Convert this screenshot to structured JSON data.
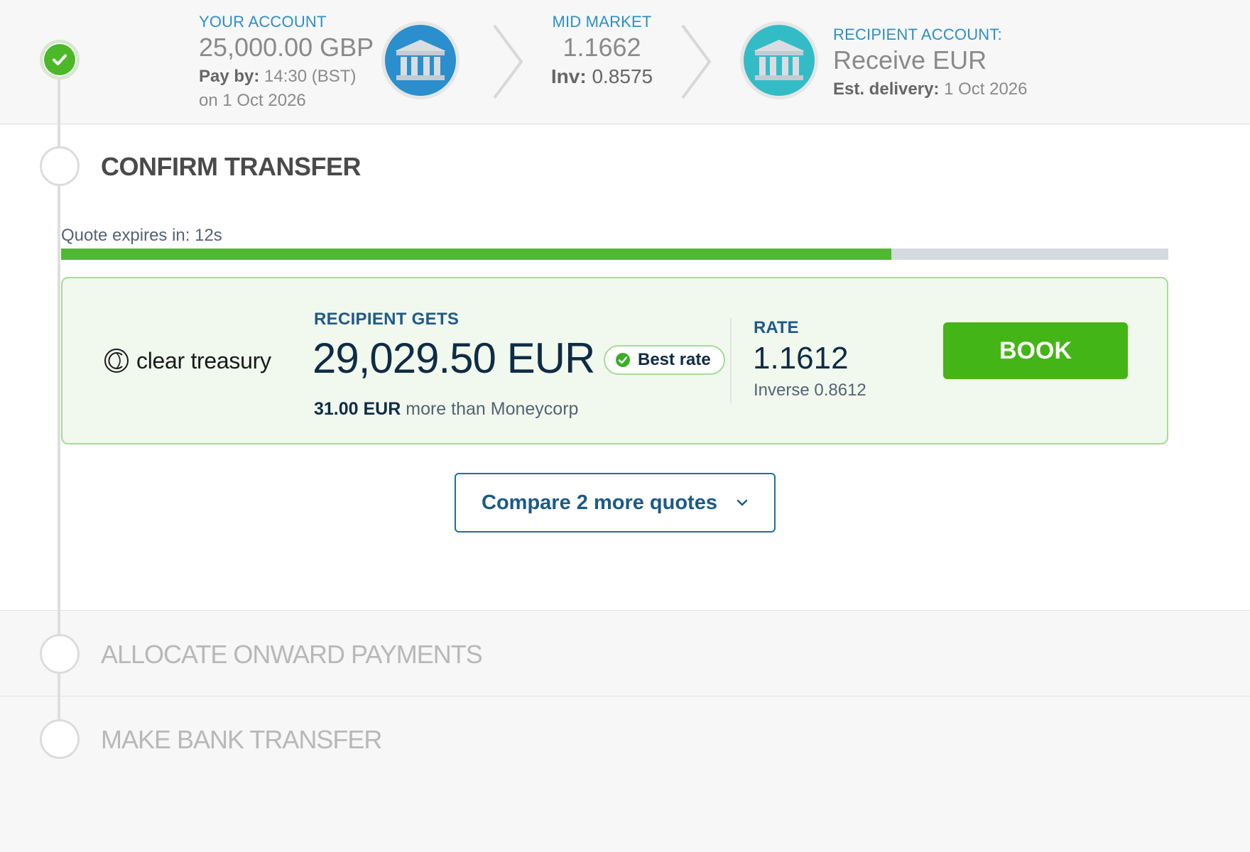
{
  "summary": {
    "your_account": {
      "label": "YOUR ACCOUNT",
      "amount": "25,000.00 GBP",
      "pay_by_label": "Pay by:",
      "pay_by_time": "14:30 (BST)",
      "pay_by_date": "on 1 Oct 2026"
    },
    "mid_market": {
      "label": "MID MARKET",
      "rate": "1.1662",
      "inv_label": "Inv:",
      "inv_value": "0.8575"
    },
    "recipient": {
      "label": "RECIPIENT ACCOUNT:",
      "receive": "Receive EUR",
      "delivery_label": "Est. delivery:",
      "delivery_date": "1 Oct 2026"
    }
  },
  "confirm": {
    "title": "CONFIRM TRANSFER",
    "expires_text": "Quote expires in: 12s",
    "progress_fraction": 0.75
  },
  "quote": {
    "provider": "clear treasury",
    "recipient_gets_label": "RECIPIENT GETS",
    "amount": "29,029.50 EUR",
    "best_rate_badge": "Best rate",
    "diff_amount": "31.00 EUR",
    "diff_text": "more than Moneycorp",
    "rate_label": "RATE",
    "rate": "1.1612",
    "inverse": "Inverse 0.8612",
    "book_label": "BOOK"
  },
  "compare": {
    "label": "Compare 2 more quotes"
  },
  "steps": {
    "allocate": "ALLOCATE ONWARD PAYMENTS",
    "bank_transfer": "MAKE BANK TRANSFER"
  },
  "colors": {
    "accent_green": "#44b516",
    "accent_blue": "#2c8fc7",
    "dark_navy": "#0f2c45"
  }
}
